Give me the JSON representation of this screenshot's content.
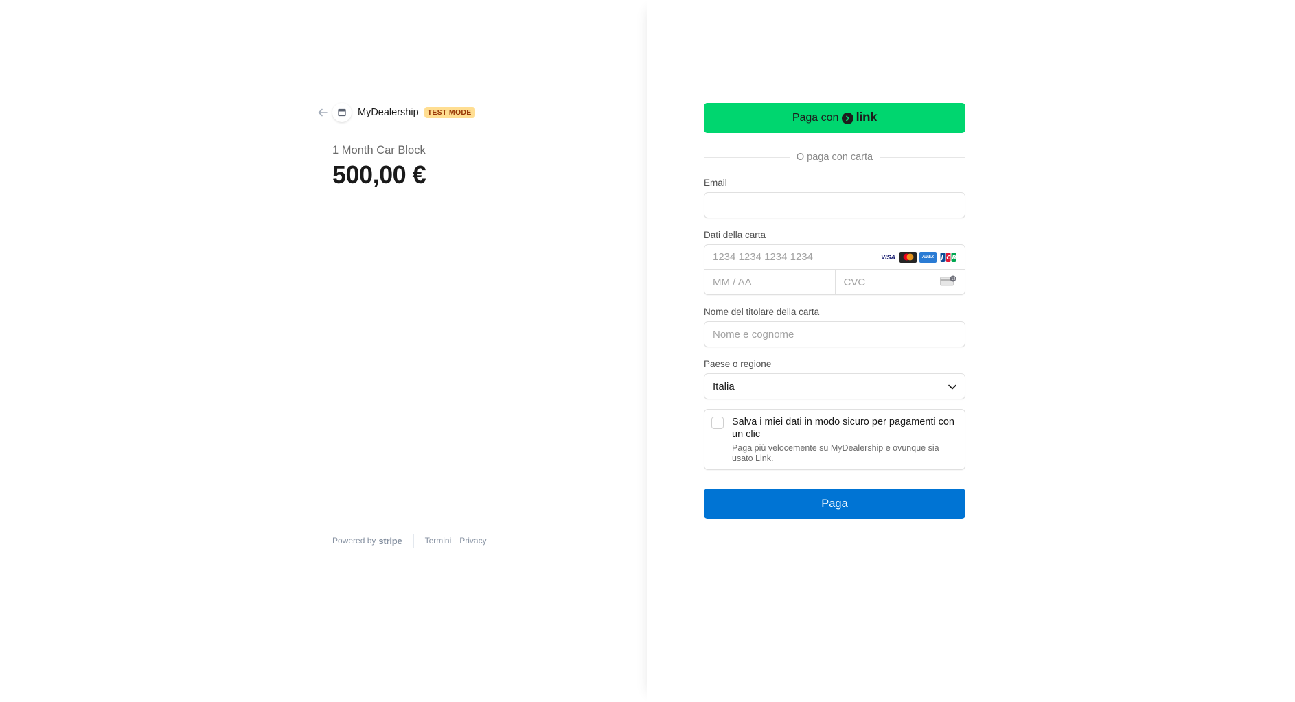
{
  "merchant": {
    "name": "MyDealership",
    "badge": "TEST MODE"
  },
  "product": {
    "name": "1 Month Car Block",
    "price": "500,00 €"
  },
  "footer": {
    "powered_by": "Powered by",
    "brand": "stripe",
    "terms": "Termini",
    "privacy": "Privacy"
  },
  "form": {
    "link_button_prefix": "Paga con",
    "link_button_brand": "link",
    "divider": "O paga con carta",
    "email_label": "Email",
    "email_value": "",
    "card_label": "Dati della carta",
    "card_number_placeholder": "1234 1234 1234 1234",
    "expiry_placeholder": "MM / AA",
    "cvc_placeholder": "CVC",
    "card_brands": [
      "VISA",
      "Mastercard",
      "AMEX",
      "JCB"
    ],
    "holder_label": "Nome del titolare della carta",
    "holder_placeholder": "Nome e cognome",
    "country_label": "Paese o regione",
    "country_value": "Italia",
    "save_title": "Salva i miei dati in modo sicuro per pagamenti con un clic",
    "save_desc": "Paga più velocemente su MyDealership e ovunque sia usato Link.",
    "save_checked": false,
    "pay_button": "Paga"
  },
  "colors": {
    "link_green": "#00d66f",
    "pay_blue": "#0074d4",
    "badge_bg": "#ffde92",
    "badge_text": "#983705"
  },
  "icons": {
    "back": "arrow-left-icon",
    "shop": "store-icon",
    "chevron": "chevron-down-icon",
    "cvc": "cvc-card-icon"
  }
}
